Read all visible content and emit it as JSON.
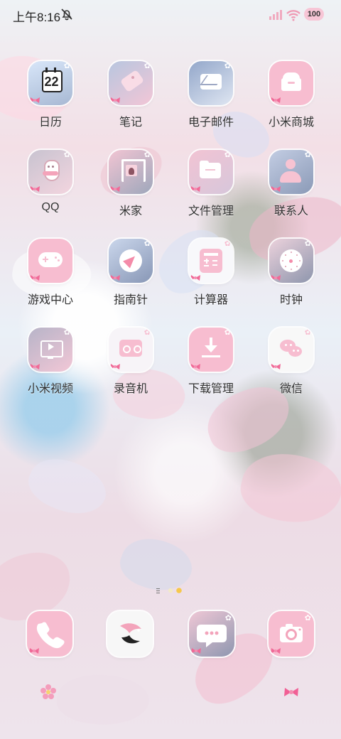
{
  "status_bar": {
    "time": "上午8:16",
    "battery": "100",
    "icons": [
      "mute-icon",
      "signal-icon",
      "wifi-icon",
      "battery-icon"
    ]
  },
  "apps": {
    "calendar": {
      "label": "日历",
      "date": "22"
    },
    "notes": {
      "label": "笔记"
    },
    "email": {
      "label": "电子邮件"
    },
    "mi_store": {
      "label": "小米商城"
    },
    "qq": {
      "label": "QQ"
    },
    "mi_home": {
      "label": "米家"
    },
    "file_manager": {
      "label": "文件管理"
    },
    "contacts": {
      "label": "联系人"
    },
    "game_center": {
      "label": "游戏中心"
    },
    "compass": {
      "label": "指南针"
    },
    "calculator": {
      "label": "计算器"
    },
    "clock": {
      "label": "时钟"
    },
    "mi_video": {
      "label": "小米视频"
    },
    "recorder": {
      "label": "录音机"
    },
    "download_manager": {
      "label": "下载管理"
    },
    "wechat": {
      "label": "微信"
    }
  },
  "dock": {
    "phone": {
      "icon": "phone-icon"
    },
    "browser": {
      "icon": "bird-icon"
    },
    "messages": {
      "icon": "message-icon"
    },
    "camera": {
      "icon": "camera-icon"
    }
  },
  "decorations": {
    "left": "pink-flower-icon",
    "right": "pink-bow-icon"
  },
  "colors": {
    "pink": "#f7b8c9",
    "pink_light": "#f7d7e1",
    "icon_white": "#ffffff",
    "label": "#303030"
  }
}
